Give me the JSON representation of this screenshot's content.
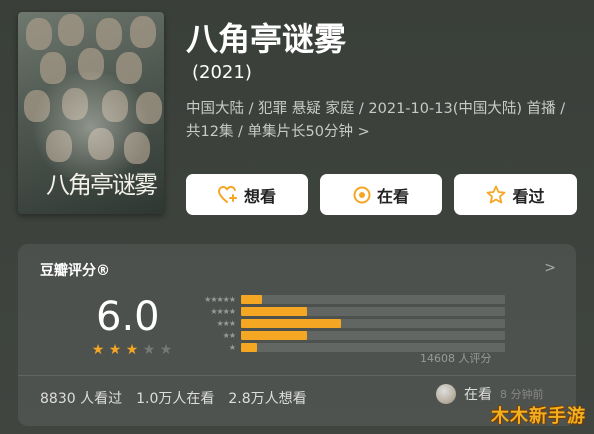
{
  "movie": {
    "title": "八角亭谜雾",
    "year": "(2021)",
    "meta": "中国大陆 / 犯罪 悬疑 家庭 / 2021-10-13(中国大陆) 首播 / 共12集 / 单集片长50分钟 >",
    "poster_title": "八角亭谜雾"
  },
  "actions": {
    "want": "想看",
    "watching": "在看",
    "watched": "看过"
  },
  "rating": {
    "card_title": "豆瓣评分®",
    "chevron": ">",
    "score": "6.0",
    "stars_filled": 3,
    "stars_total": 5,
    "distribution": [
      {
        "label": "★★★★★",
        "percent": 8
      },
      {
        "label": "★★★★",
        "percent": 25
      },
      {
        "label": "★★★",
        "percent": 38
      },
      {
        "label": "★★",
        "percent": 25
      },
      {
        "label": "★",
        "percent": 6
      }
    ],
    "count": "14608 人评分",
    "accent_color": "#f5a623"
  },
  "stats": {
    "watched": "8830 人看过",
    "watching": "1.0万人在看",
    "want": "2.8万人想看"
  },
  "status": {
    "label": "在看",
    "time": "8 分钟前"
  },
  "watermark": "木木新手游"
}
